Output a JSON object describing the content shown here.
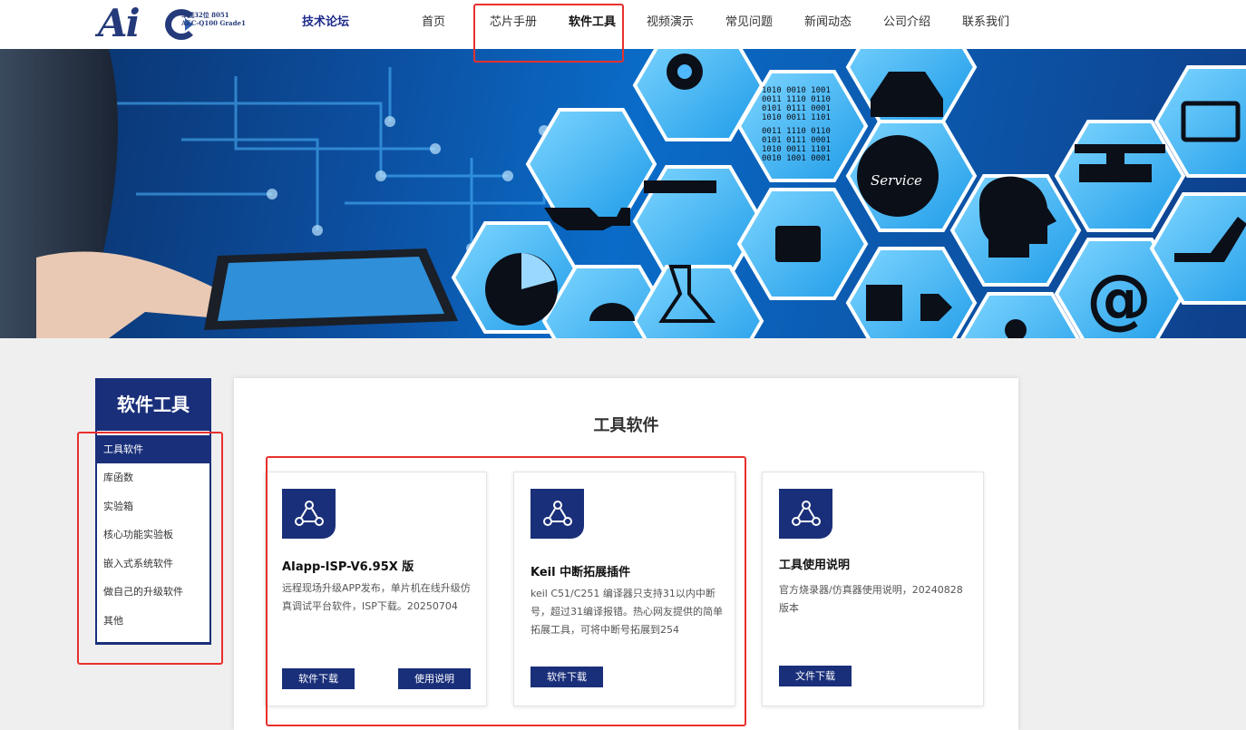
{
  "header": {
    "logo_main": "Ai",
    "logo_sub": "车规32位 8051\nAEC-Q100 Grade1",
    "forum": "技术论坛",
    "nav": [
      "首页",
      "芯片手册",
      "软件工具",
      "视频演示",
      "常见问题",
      "新闻动态",
      "公司介绍",
      "联系我们"
    ],
    "active_nav": "软件工具"
  },
  "banner": {
    "binary_text": [
      "1010 0010 1001",
      "0011 1110 0110",
      "0101 0111 0001",
      "1010 0011 1101",
      "0011 1110 0110",
      "0101 0111 0001",
      "1010 0011 1101",
      "0010 1001 0001"
    ],
    "service_label": "Service",
    "at_sign": "@"
  },
  "sidebar": {
    "title": "软件工具",
    "items": [
      "工具软件",
      "库函数",
      "实验箱",
      "核心功能实验板",
      "嵌入式系统软件",
      "做自己的升级软件",
      "其他"
    ],
    "active_item": "工具软件"
  },
  "main": {
    "title": "工具软件",
    "cards": [
      {
        "title": "AIapp-ISP-V6.95X 版",
        "desc": "远程现场升级APP发布，单片机在线升级仿真调试平台软件，ISP下载。20250704",
        "buttons": [
          "软件下载",
          "使用说明"
        ]
      },
      {
        "title": "Keil 中断拓展插件",
        "desc": "keil C51/C251 编译器只支持31以内中断号，超过31编译报错。热心网友提供的简单拓展工具，可将中断号拓展到254",
        "buttons": [
          "软件下载"
        ]
      },
      {
        "title": "工具使用说明",
        "desc": "官方烧录器/仿真器使用说明，20240828版本",
        "buttons": [
          "文件下载"
        ]
      }
    ]
  },
  "colors": {
    "primary": "#1a2f7a",
    "annotation_red": "#e8302e",
    "banner_blue": "#0a6cc8"
  },
  "icons": {
    "card_icon": "share-icon"
  }
}
